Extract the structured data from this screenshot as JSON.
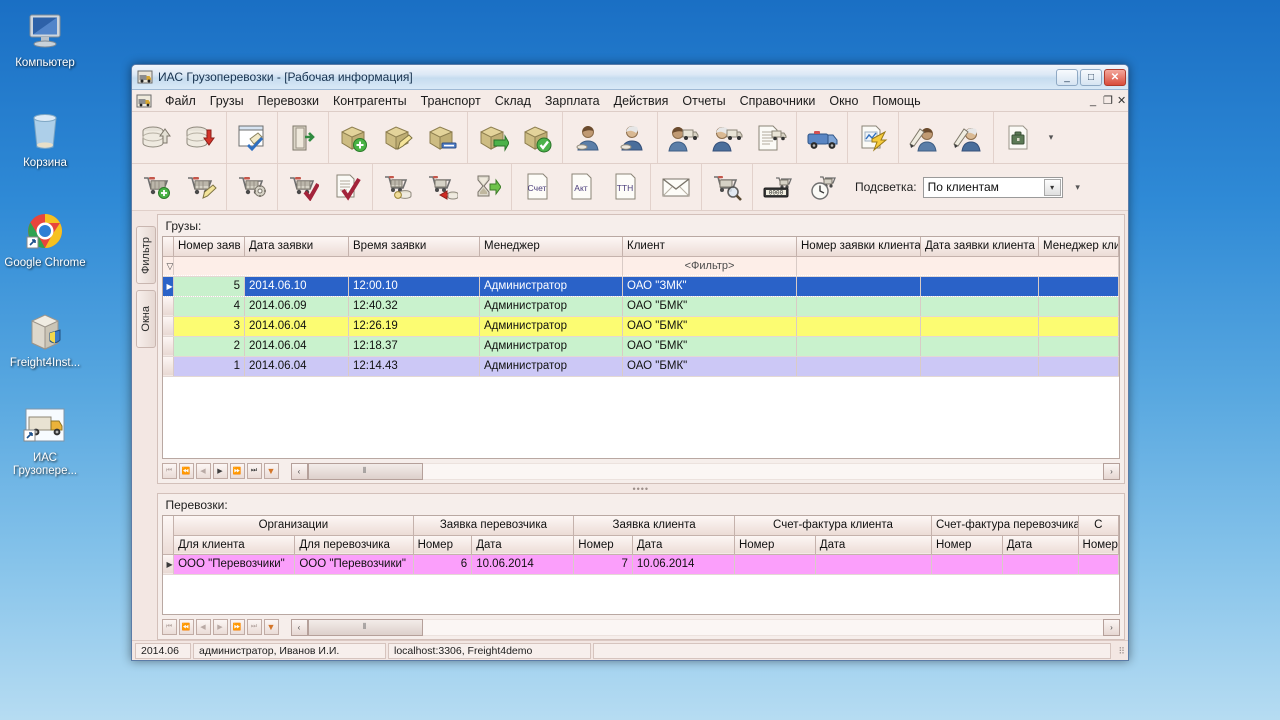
{
  "desktop": {
    "icons": [
      {
        "name": "computer",
        "label": "Компьютер"
      },
      {
        "name": "recycle-bin",
        "label": "Корзина"
      },
      {
        "name": "google-chrome",
        "label": "Google Chrome"
      },
      {
        "name": "freight4-installer",
        "label": "Freight4Inst..."
      },
      {
        "name": "ias-truck-app",
        "label": "ИАС Грузопере..."
      }
    ]
  },
  "window": {
    "title": "ИАС Грузоперевозки - [Рабочая информация]",
    "buttons": {
      "minimize": "_",
      "maximize": "□",
      "close": "✕"
    },
    "mdi_buttons": {
      "minimize": "_",
      "restore": "❐",
      "close": "✕"
    }
  },
  "menu": {
    "items": [
      "Файл",
      "Грузы",
      "Перевозки",
      "Контрагенты",
      "Транспорт",
      "Склад",
      "Зарплата",
      "Действия",
      "Отчеты",
      "Справочники",
      "Окно",
      "Помощь"
    ]
  },
  "toolbar_top": {
    "groups": [
      {
        "buttons": [
          {
            "name": "db-upload-button",
            "icon": "database-up"
          },
          {
            "name": "db-download-button",
            "icon": "database-down"
          }
        ]
      },
      {
        "buttons": [
          {
            "name": "workspace-edit-button",
            "icon": "window-check"
          }
        ]
      },
      {
        "buttons": [
          {
            "name": "open-door-button",
            "icon": "door-enter"
          }
        ]
      },
      {
        "buttons": [
          {
            "name": "cargo-add-button",
            "icon": "box-plus"
          },
          {
            "name": "cargo-edit-button",
            "icon": "box-pencil"
          },
          {
            "name": "cargo-delete-button",
            "icon": "box-minus"
          }
        ]
      },
      {
        "buttons": [
          {
            "name": "cargo-move-button",
            "icon": "box-arrow"
          },
          {
            "name": "cargo-confirm-button",
            "icon": "box-check"
          }
        ]
      },
      {
        "buttons": [
          {
            "name": "client-card-button",
            "icon": "user-male"
          },
          {
            "name": "carrier-card-button",
            "icon": "user-female"
          }
        ]
      },
      {
        "buttons": [
          {
            "name": "client-transport-button",
            "icon": "user-male-truck"
          },
          {
            "name": "carrier-transport-button",
            "icon": "user-female-truck"
          },
          {
            "name": "document-transport-button",
            "icon": "doc-truck"
          }
        ]
      },
      {
        "buttons": [
          {
            "name": "truck-button",
            "icon": "truck"
          }
        ]
      },
      {
        "buttons": [
          {
            "name": "report-run-button",
            "icon": "doc-lightning"
          }
        ]
      },
      {
        "buttons": [
          {
            "name": "edit-client-button",
            "icon": "pen-user-male"
          },
          {
            "name": "edit-carrier-button",
            "icon": "pen-user-female"
          }
        ]
      },
      {
        "buttons": [
          {
            "name": "doc-archive-button",
            "icon": "doc-case"
          }
        ]
      }
    ],
    "overflow": "▾"
  },
  "toolbar_bottom": {
    "groups": [
      {
        "buttons": [
          {
            "name": "order-add-button",
            "icon": "cart-plus"
          },
          {
            "name": "order-edit-button",
            "icon": "cart-pencil"
          }
        ]
      },
      {
        "buttons": [
          {
            "name": "order-settings-button",
            "icon": "cart-gear"
          }
        ]
      },
      {
        "buttons": [
          {
            "name": "order-confirm-button",
            "icon": "cart-check"
          },
          {
            "name": "document-confirm-button",
            "icon": "doc-check"
          }
        ]
      },
      {
        "buttons": [
          {
            "name": "order-payment-button",
            "icon": "cart-coins"
          },
          {
            "name": "order-refund-button",
            "icon": "cart-back-coins"
          },
          {
            "name": "order-pending-button",
            "icon": "hourglass-go"
          }
        ]
      },
      {
        "buttons": [
          {
            "name": "invoice-button",
            "icon": "doc",
            "text": "Счет"
          },
          {
            "name": "act-button",
            "icon": "doc",
            "text": "Акт"
          },
          {
            "name": "ttn-button",
            "icon": "doc",
            "text": "ТТН"
          }
        ]
      },
      {
        "buttons": [
          {
            "name": "mail-button",
            "icon": "envelope"
          }
        ]
      },
      {
        "buttons": [
          {
            "name": "order-search-button",
            "icon": "cart-search"
          }
        ]
      },
      {
        "buttons": [
          {
            "name": "counter-button",
            "icon": "counter"
          },
          {
            "name": "order-clock-button",
            "icon": "cart-clock"
          }
        ]
      }
    ],
    "highlight": {
      "label": "Подсветка:",
      "value": "По клиентам",
      "arrow": "▾"
    },
    "overflow": "▾"
  },
  "side_tabs": [
    {
      "name": "filter-tab",
      "label": "Фильтр"
    },
    {
      "name": "windows-tab",
      "label": "Окна"
    }
  ],
  "cargo_pane": {
    "caption": "Грузы:",
    "columns": [
      "Номер заяв",
      "Дата заявки",
      "Время заявки",
      "Менеджер",
      "Клиент",
      "Номер заявки клиента",
      "Дата заявки клиента",
      "Менеджер клие"
    ],
    "filter_text": "<Фильтр>",
    "rows": [
      {
        "color": "selected",
        "cells": [
          "5",
          "2014.06.10",
          "12:00.10",
          "Администратор",
          "ОАО \"ЗМК\"",
          "",
          "",
          ""
        ]
      },
      {
        "color": "green",
        "cells": [
          "4",
          "2014.06.09",
          "12:40.32",
          "Администратор",
          "ОАО \"БМК\"",
          "",
          "",
          ""
        ]
      },
      {
        "color": "yellow",
        "cells": [
          "3",
          "2014.06.04",
          "12:26.19",
          "Администратор",
          "ОАО \"БМК\"",
          "",
          "",
          ""
        ]
      },
      {
        "color": "green",
        "cells": [
          "2",
          "2014.06.04",
          "12:18.37",
          "Администратор",
          "ОАО \"БМК\"",
          "",
          "",
          ""
        ]
      },
      {
        "color": "violet",
        "cells": [
          "1",
          "2014.06.04",
          "12:14.43",
          "Администратор",
          "ОАО \"БМК\"",
          "",
          "",
          ""
        ]
      }
    ],
    "navigator": [
      "⏮",
      "⏪",
      "◀",
      "▶",
      "⏩",
      "⏭",
      "▼"
    ]
  },
  "transport_pane": {
    "caption": "Перевозки:",
    "group_headers": [
      {
        "label": "Организации",
        "span": 2
      },
      {
        "label": "Заявка перевозчика",
        "span": 2
      },
      {
        "label": "Заявка клиента",
        "span": 2
      },
      {
        "label": "Счет-фактура клиента",
        "span": 2
      },
      {
        "label": "Счет-фактура перевозчика",
        "span": 2
      },
      {
        "label": "С",
        "span": 1
      }
    ],
    "columns": [
      "Для клиента",
      "Для перевозчика",
      "Номер",
      "Дата",
      "Номер",
      "Дата",
      "Номер",
      "Дата",
      "Номер",
      "Дата",
      "Номер"
    ],
    "rows": [
      {
        "color": "pink",
        "cells": [
          "ООО \"Перевозчики\"",
          "ООО \"Перевозчики\"",
          "6",
          "10.06.2014",
          "7",
          "10.06.2014",
          "",
          "",
          "",
          "",
          ""
        ]
      }
    ],
    "navigator": [
      "⏮",
      "⏪",
      "◀",
      "▶",
      "⏩",
      "⏭",
      "▼"
    ]
  },
  "statusbar": {
    "period": "2014.06",
    "user": "администратор, Иванов И.И.",
    "connection": "localhost:3306, Freight4demo",
    "extra": ""
  }
}
